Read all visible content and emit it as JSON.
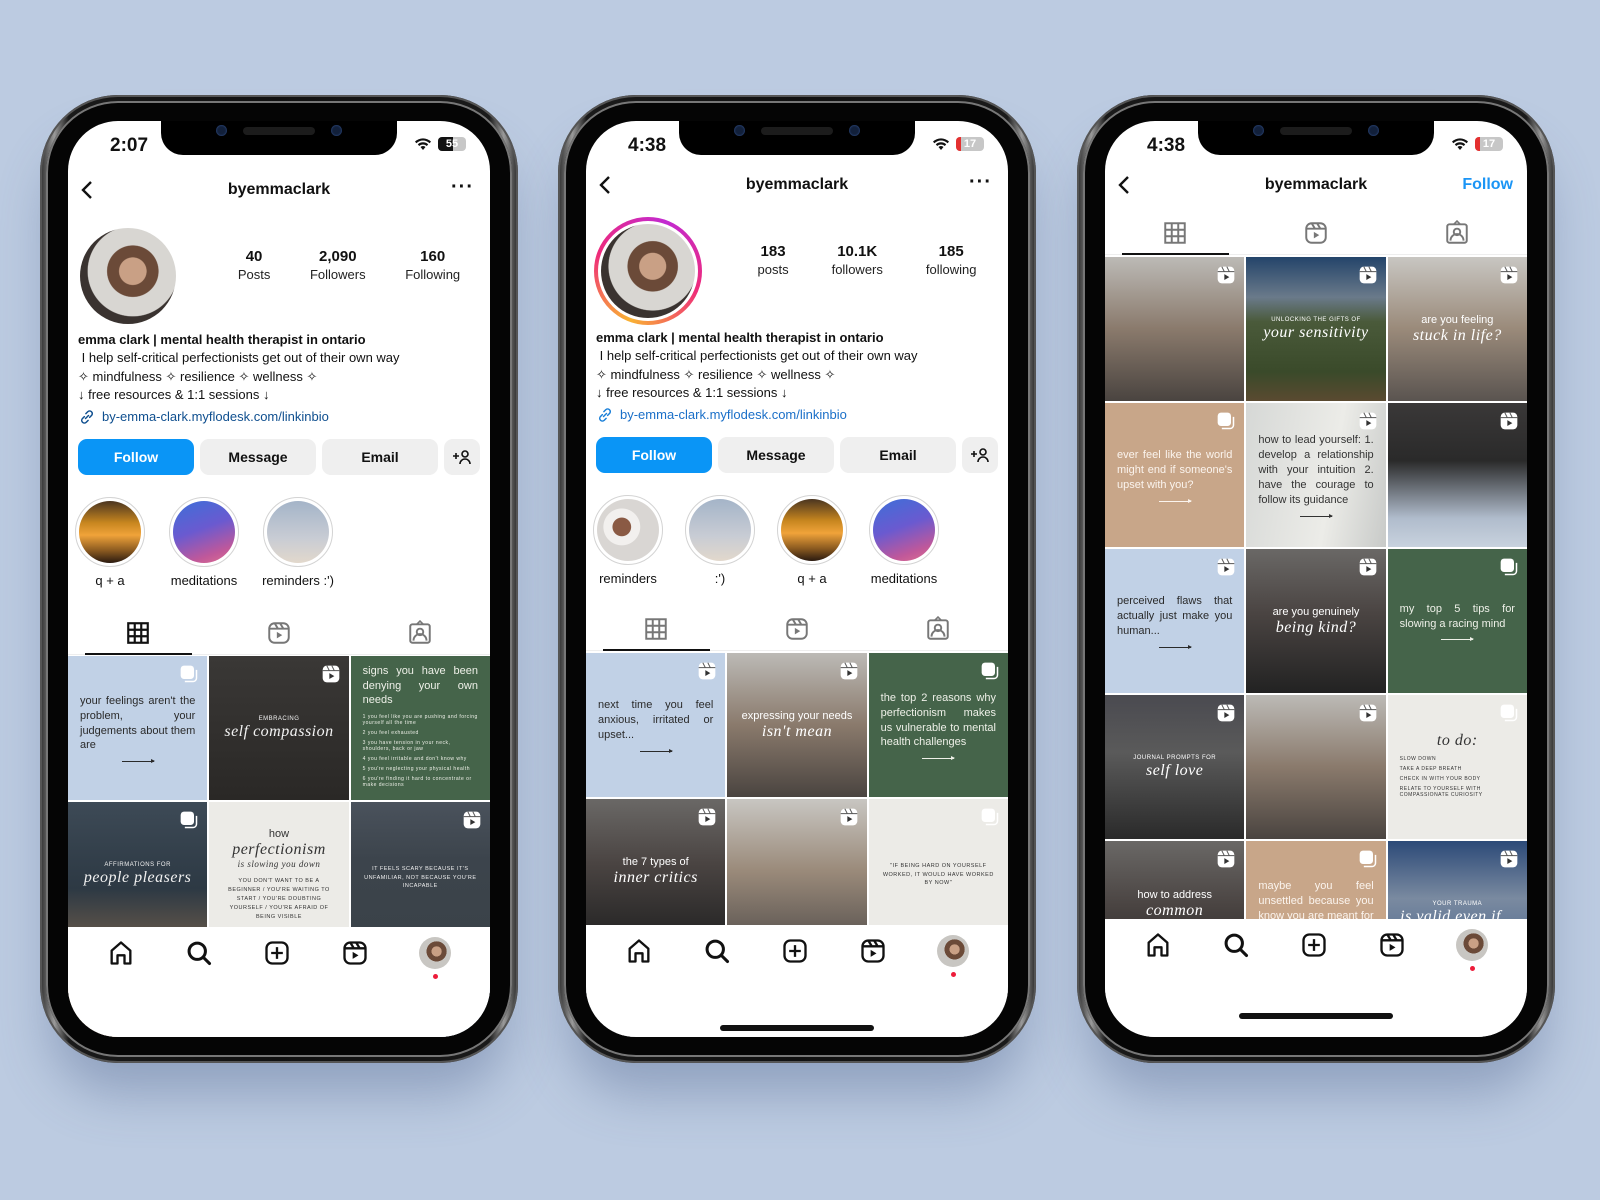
{
  "colors": {
    "background": "#bccbe1",
    "follow_blue": "#0a95f6",
    "link_blue": "#0f4f8f",
    "notification_red": "#ed1c3a"
  },
  "phones": [
    {
      "status": {
        "time": "2:07",
        "battery": "55",
        "battery_fraction": 0.55
      },
      "header": {
        "username": "byemmaclark",
        "more_icon": "more-icon",
        "back_icon": "back-chevron-icon"
      },
      "stats": [
        {
          "value": "40",
          "label": "Posts"
        },
        {
          "value": "2,090",
          "label": "Followers"
        },
        {
          "value": "160",
          "label": "Following"
        }
      ],
      "bio": {
        "name": "emma clark | mental health therapist in ontario",
        "lines": [
          "඿ I help self-critical perfectionists get out of their own way",
          "✧ mindfulness ✧ resilience ✧ wellness ✧",
          "↓ free resources & 1:1 sessions ↓"
        ],
        "link": "by-emma-clark.myflodesk.com/linkinbio"
      },
      "actions": {
        "follow": "Follow",
        "message": "Message",
        "email": "Email",
        "add_user": "+👤"
      },
      "highlights": [
        {
          "label": "q + a",
          "style": "sunset"
        },
        {
          "label": "meditations",
          "style": "galaxy"
        },
        {
          "label": "reminders :')",
          "style": "sky"
        }
      ],
      "tabs": [
        "grid",
        "reels",
        "tagged"
      ],
      "grid": [
        {
          "style": "blue",
          "badge": "carousel",
          "text": "your feelings aren't the problem, your judgements about them are"
        },
        {
          "style": "dark",
          "badge": "reel",
          "kicker": "EMBRACING",
          "title": "self compassion"
        },
        {
          "style": "green",
          "badge": "none",
          "text": "signs you have been denying your own needs",
          "list": [
            "1 you feel like you are pushing and forcing yourself all the time",
            "2 you feel exhausted",
            "3 you have tension in your neck, shoulders, back or jaw",
            "4 you feel irritable and don't know why",
            "5 you're neglecting your physical health",
            "6 you're finding it hard to concentrate or make decisions"
          ]
        },
        {
          "style": "sea",
          "badge": "carousel",
          "kicker": "AFFIRMATIONS FOR",
          "title": "people pleasers"
        },
        {
          "style": "cream",
          "badge": "none",
          "kicker": "how",
          "title": "perfectionism",
          "sub": "is slowing you down",
          "text": "YOU DON'T WANT TO BE A BEGINNER / YOU'RE WAITING TO START / YOU'RE DOUBTING YOURSELF / YOU'RE AFRAID OF BEING VISIBLE"
        },
        {
          "style": "lake",
          "badge": "reel",
          "text": "IT FEELS SCARY BECAUSE IT'S UNFAMILIAR, NOT BECAUSE YOU'RE INCAPABLE"
        }
      ],
      "partial_row": [
        "tan",
        "gray",
        "blue"
      ]
    },
    {
      "status": {
        "time": "4:38",
        "battery": "17",
        "battery_fraction": 0.17
      },
      "header": {
        "username": "byemmaclark",
        "more_icon": "more-icon",
        "back_icon": "back-chevron-icon"
      },
      "stats": [
        {
          "value": "183",
          "label": "posts"
        },
        {
          "value": "10.1K",
          "label": "followers"
        },
        {
          "value": "185",
          "label": "following"
        }
      ],
      "bio": {
        "name": "emma clark | mental health therapist in ontario",
        "lines": [
          "඿ I help self-critical perfectionists get out of their own way",
          "✧ mindfulness ✧ resilience ✧ wellness ✧",
          "↓ free resources & 1:1 sessions ↓"
        ],
        "link": "by-emma-clark.myflodesk.com/linkinbio"
      },
      "actions": {
        "follow": "Follow",
        "message": "Message",
        "email": "Email",
        "add_user": "+👤"
      },
      "highlights": [
        {
          "label": "reminders",
          "style": "cup"
        },
        {
          "label": ":')",
          "style": "sky"
        },
        {
          "label": "q + a",
          "style": "sunset"
        },
        {
          "label": "meditations",
          "style": "galaxy"
        }
      ],
      "tabs": [
        "grid",
        "reels",
        "tagged"
      ],
      "grid": [
        {
          "style": "blue",
          "badge": "reel",
          "text": "next time you feel anxious, irritated or upset..."
        },
        {
          "style": "photo",
          "badge": "reel",
          "kicker": "expressing your needs",
          "title": "isn't mean"
        },
        {
          "style": "green",
          "badge": "carousel",
          "text": "the top 2 reasons why perfectionism makes us vulnerable to mental health challenges"
        },
        {
          "style": "face-dark",
          "badge": "reel",
          "kicker": "the 7 types of",
          "title": "inner critics"
        },
        {
          "style": "photo2",
          "badge": "reel"
        },
        {
          "style": "cream",
          "badge": "carousel",
          "text": "\"IF BEING HARD ON YOURSELF WORKED, IT WOULD HAVE WORKED BY NOW\""
        }
      ],
      "partial_row": [
        "gray",
        "tan",
        "gray"
      ]
    },
    {
      "status": {
        "time": "4:38",
        "battery": "17",
        "battery_fraction": 0.17
      },
      "header": {
        "username": "byemmaclark",
        "follow": "Follow",
        "back_icon": "back-chevron-icon"
      },
      "tabs": [
        "grid",
        "reels",
        "tagged"
      ],
      "grid": [
        {
          "style": "photo",
          "badge": "reel"
        },
        {
          "style": "mountain",
          "badge": "reel",
          "kicker": "UNLOCKING THE GIFTS OF",
          "title": "your sensitivity"
        },
        {
          "style": "photo2",
          "badge": "reel",
          "kicker": "are you feeling",
          "title": "stuck in life?"
        },
        {
          "style": "tan",
          "badge": "carousel",
          "text": "ever feel like the world might end if someone's upset with you?"
        },
        {
          "style": "book",
          "badge": "reel",
          "text": "how to lead yourself: 1. develop a relationship with your intuition 2. have the courage to follow its guidance"
        },
        {
          "style": "car",
          "badge": "reel"
        },
        {
          "style": "blue",
          "badge": "reel",
          "text": "perceived flaws that actually just make you human..."
        },
        {
          "style": "face-dark",
          "badge": "reel",
          "kicker": "are you genuinely",
          "title": "being kind?"
        },
        {
          "style": "green",
          "badge": "carousel",
          "text": "my top 5 tips for slowing a racing mind"
        },
        {
          "style": "patio",
          "badge": "reel",
          "kicker": "JOURNAL PROMPTS FOR",
          "title": "self love"
        },
        {
          "style": "photo",
          "badge": "reel"
        },
        {
          "style": "cream",
          "badge": "carousel",
          "title": "to do:",
          "list": [
            "SLOW DOWN",
            "TAKE A DEEP BREATH",
            "CHECK IN WITH YOUR BODY",
            "RELATE TO YOURSELF WITH COMPASSIONATE CURIOSITY"
          ]
        },
        {
          "style": "face-dark",
          "badge": "reel",
          "kicker": "how to address",
          "title": "common triggers"
        },
        {
          "style": "tan",
          "badge": "carousel",
          "text": "maybe you feel unsettled because you know you are meant for more..."
        },
        {
          "style": "sky",
          "badge": "reel",
          "kicker": "YOUR TRAUMA",
          "title": "is valid even if..."
        }
      ]
    }
  ],
  "bottom_nav": [
    "home-icon",
    "search-icon",
    "create-icon",
    "reels-icon",
    "profile-avatar"
  ]
}
